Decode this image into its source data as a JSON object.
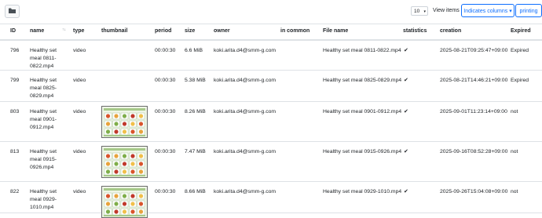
{
  "toolbar": {
    "per_page": "10",
    "view_items_label": "View items",
    "columns_label": "Indicates columns",
    "print_label": "printing"
  },
  "columns": [
    "ID",
    "name",
    "type",
    "thumbnail",
    "period",
    "size",
    "owner",
    "in common",
    "File name",
    "statistics",
    "creation",
    "Expired"
  ],
  "sort_indicator": "↑↓",
  "rows": [
    {
      "id": "796",
      "name": "Healthy set meal 0811-0822.mp4",
      "type": "video",
      "has_thumb": false,
      "period": "00:00:30",
      "size": "6.6 MiB",
      "owner": "koki.arita.d4@smm-g.com",
      "common": "",
      "file": "Healthy set meal 0811-0822.mp4",
      "stats": "✔",
      "created": "2025-08-21T09:25:47+09:00",
      "expired": "Expired"
    },
    {
      "id": "799",
      "name": "Healthy set meal 0825-0829.mp4",
      "type": "video",
      "has_thumb": false,
      "period": "00:00:30",
      "size": "5.38 MiB",
      "owner": "koki.arita.d4@smm-g.com",
      "common": "",
      "file": "Healthy set meal 0825-0829.mp4",
      "stats": "✔",
      "created": "2025-08-21T14:46:21+09:00",
      "expired": "Expired"
    },
    {
      "id": "803",
      "name": "Healthy set meal 0901-0912.mp4",
      "type": "video",
      "has_thumb": true,
      "period": "00:00:30",
      "size": "8.26 MiB",
      "owner": "koki.arita.d4@smm-g.com",
      "common": "",
      "file": "Healthy set meal 0901-0912.mp4",
      "stats": "✔",
      "created": "2025-09-01T11:23:14+09:00",
      "expired": "not"
    },
    {
      "id": "813",
      "name": "Healthy set meal 0915-0926.mp4",
      "type": "video",
      "has_thumb": true,
      "period": "00:00:30",
      "size": "7.47 MiB",
      "owner": "koki.arita.d4@smm-g.com",
      "common": "",
      "file": "Healthy set meal 0915-0926.mp4",
      "stats": "✔",
      "created": "2025-09-16T08:52:28+09:00",
      "expired": "not"
    },
    {
      "id": "822",
      "name": "Healthy set meal 0929-1010.mp4",
      "type": "video",
      "has_thumb": true,
      "period": "00:00:30",
      "size": "8.66 MiB",
      "owner": "koki.arita.d4@smm-g.com",
      "common": "",
      "file": "Healthy set meal 0929-1010.mp4",
      "stats": "✔",
      "created": "2025-09-26T15:04:08+09:00",
      "expired": "not"
    }
  ]
}
